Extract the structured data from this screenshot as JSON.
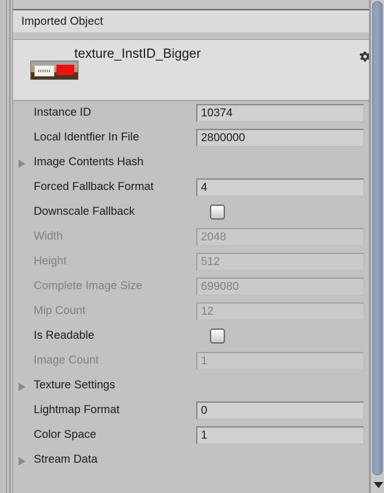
{
  "panel": {
    "section_header": "Imported Object",
    "object_name": "texture_InstID_Bigger",
    "gear_icon": "gear-icon",
    "thumbnail_icon": "texture-thumbnail-icon",
    "scrollbar_down_icon": "chevron-down-icon"
  },
  "colors": {
    "panel_bg": "#c2c2c2",
    "header_bg": "#dcdcdc",
    "card_bg": "#dedede",
    "field_bg": "#d0d0d0",
    "field_bg_disabled": "#cacaca",
    "text": "#1d1d1d",
    "text_disabled": "#808080",
    "foldout_arrow": "#8b8b8b",
    "scrollbar_thumb": "#8c9cb5",
    "thumb_red": "#ee1111"
  },
  "properties": [
    {
      "label": "Instance ID",
      "value": "10374",
      "control": "field",
      "disabled": false,
      "foldout": false,
      "clip": false
    },
    {
      "label": "Local Identfier In File",
      "value": "2800000",
      "control": "field",
      "disabled": false,
      "foldout": false,
      "clip": false
    },
    {
      "label": "Image Contents Hash",
      "value": "",
      "control": "none",
      "disabled": false,
      "foldout": true,
      "clip": false
    },
    {
      "label": "Forced Fallback Format",
      "value": "4",
      "control": "field",
      "disabled": false,
      "foldout": false,
      "clip": true
    },
    {
      "label": "Downscale Fallback",
      "value": "",
      "control": "checkbox",
      "disabled": false,
      "foldout": false,
      "clip": false,
      "checked": false
    },
    {
      "label": "Width",
      "value": "2048",
      "control": "field",
      "disabled": true,
      "foldout": false,
      "clip": false
    },
    {
      "label": "Height",
      "value": "512",
      "control": "field",
      "disabled": true,
      "foldout": false,
      "clip": false
    },
    {
      "label": "Complete Image Size",
      "value": "699080",
      "control": "field",
      "disabled": true,
      "foldout": false,
      "clip": false
    },
    {
      "label": "Mip Count",
      "value": "12",
      "control": "field",
      "disabled": true,
      "foldout": false,
      "clip": false
    },
    {
      "label": "Is Readable",
      "value": "",
      "control": "checkbox",
      "disabled": false,
      "foldout": false,
      "clip": false,
      "checked": false
    },
    {
      "label": "Image Count",
      "value": "1",
      "control": "field",
      "disabled": true,
      "foldout": false,
      "clip": false
    },
    {
      "label": "Texture Settings",
      "value": "",
      "control": "none",
      "disabled": false,
      "foldout": true,
      "clip": false
    },
    {
      "label": "Lightmap Format",
      "value": "0",
      "control": "field",
      "disabled": false,
      "foldout": false,
      "clip": false
    },
    {
      "label": "Color Space",
      "value": "1",
      "control": "field",
      "disabled": false,
      "foldout": false,
      "clip": false
    },
    {
      "label": "Stream Data",
      "value": "",
      "control": "none",
      "disabled": false,
      "foldout": true,
      "clip": false
    }
  ]
}
